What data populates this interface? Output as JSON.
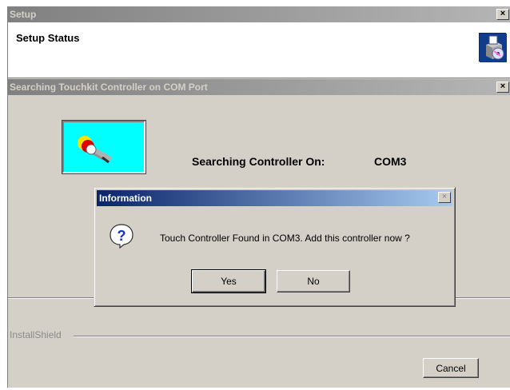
{
  "setup_window": {
    "title": "Setup",
    "close_glyph": "×",
    "header_title": "Setup Status",
    "header_icon": "installer-box-icon"
  },
  "search_window": {
    "title": "Searching Touchkit Controller on COM Port",
    "close_glyph": "×",
    "searching_label": "Searching Controller On:",
    "port": "COM3",
    "plug_icon": "serial-plug-icon",
    "footer_brand": "InstallShield",
    "cancel_label": "Cancel"
  },
  "info_dialog": {
    "title": "Information",
    "close_glyph": "×",
    "icon": "question-icon",
    "message": "Touch Controller Found in COM3. Add this controller now ?",
    "yes_label": "Yes",
    "no_label": "No"
  },
  "colors": {
    "active_title_start": "#0a246a",
    "active_title_end": "#a6caf0",
    "inactive_title": "#808080",
    "face": "#d4d0c8",
    "plug_box": "#00ffff"
  }
}
